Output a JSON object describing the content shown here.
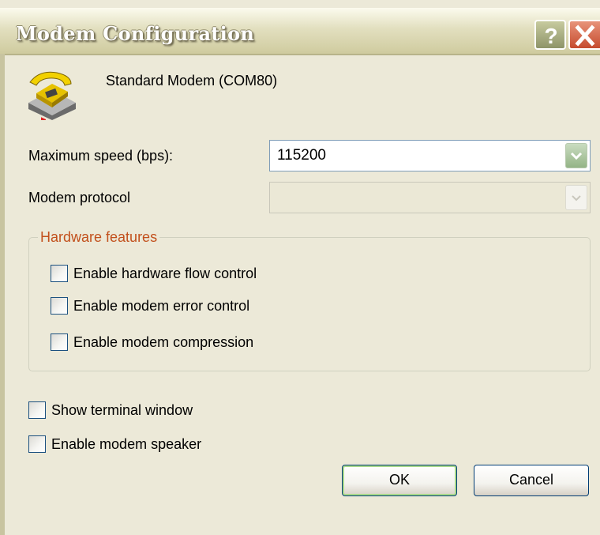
{
  "window": {
    "title": "Modem Configuration",
    "help_icon": "question-mark-icon",
    "close_icon": "close-x-icon"
  },
  "device": {
    "icon": "telephone-modem-icon",
    "name": "Standard Modem (COM80)"
  },
  "max_speed": {
    "label": "Maximum speed (bps):",
    "value": "115200"
  },
  "protocol": {
    "label": "Modem protocol",
    "value": ""
  },
  "hardware": {
    "title": "Hardware features",
    "options": [
      {
        "label": "Enable hardware flow control",
        "checked": false
      },
      {
        "label": "Enable modem error control",
        "checked": false
      },
      {
        "label": "Enable modem compression",
        "checked": false
      }
    ]
  },
  "options": [
    {
      "label": "Show terminal window",
      "checked": false
    },
    {
      "label": "Enable modem speaker",
      "checked": false
    }
  ],
  "buttons": {
    "ok": "OK",
    "cancel": "Cancel"
  },
  "colors": {
    "dialog_bg": "#ece9d8",
    "group_title": "#c2501c",
    "close_button": "#c64b2e"
  }
}
